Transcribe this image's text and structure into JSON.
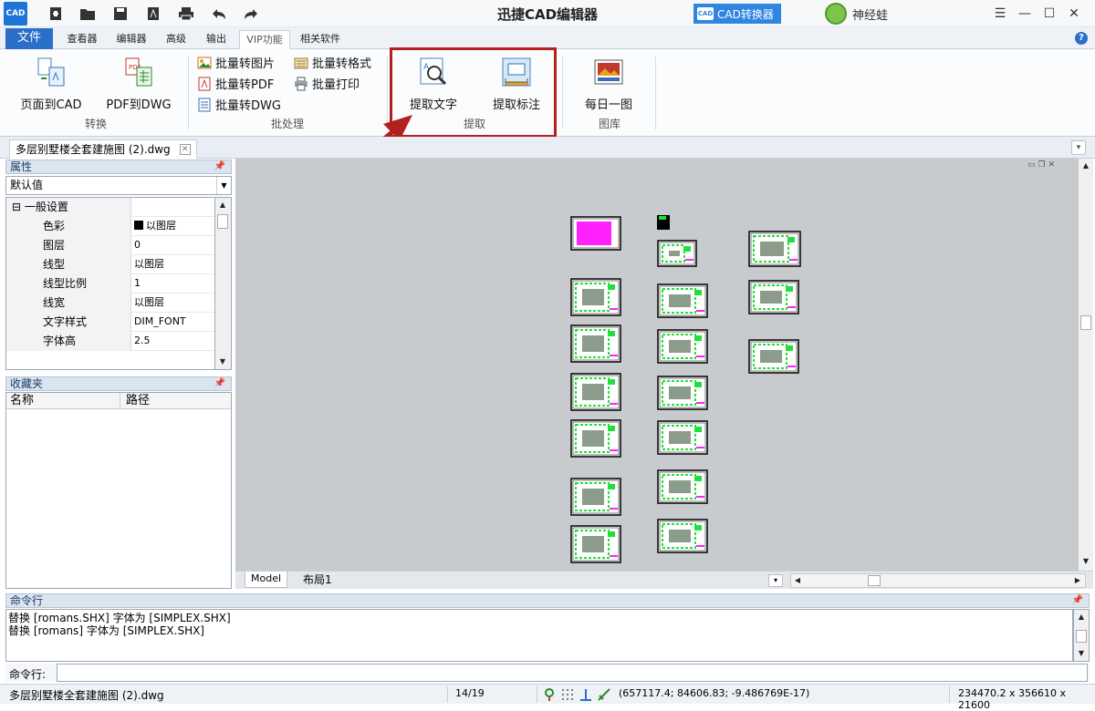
{
  "title_bar": {
    "logo_text": "CAD",
    "app_title": "迅捷CAD编辑器",
    "converter_button": "CAD转换器",
    "converter_icon_text": "CAD",
    "user_name": "神经蛙",
    "quick_access_icons": [
      "new-file-icon",
      "open-folder-icon",
      "save-icon",
      "pdf-icon",
      "print-icon",
      "undo-icon",
      "redo-icon"
    ],
    "window_controls": [
      "menu-icon",
      "minimize-icon",
      "maximize-icon",
      "close-icon"
    ]
  },
  "ribbon_tabs": [
    "文件",
    "查看器",
    "编辑器",
    "高级",
    "输出",
    "VIP功能",
    "相关软件"
  ],
  "active_tab": "VIP功能",
  "ribbon": {
    "groups": {
      "convert": {
        "label": "转换",
        "page_to_cad": "页面到CAD",
        "pdf_to_dwg": "PDF到DWG"
      },
      "batch": {
        "label": "批处理",
        "to_image": "批量转图片",
        "to_pdf": "批量转PDF",
        "to_dwg": "批量转DWG",
        "to_format": "批量转格式",
        "print": "批量打印"
      },
      "extract": {
        "label": "提取",
        "extract_text": "提取文字",
        "extract_dimension": "提取标注"
      },
      "gallery": {
        "label": "图库",
        "daily_image": "每日一图"
      }
    }
  },
  "document_tab": {
    "name": "多层别墅楼全套建施图 (2).dwg"
  },
  "properties_panel": {
    "title": "属性",
    "selector_value": "默认值",
    "category": "一般设置",
    "rows": [
      {
        "key": "色彩",
        "value": "以图层"
      },
      {
        "key": "图层",
        "value": "0"
      },
      {
        "key": "线型",
        "value": "以图层"
      },
      {
        "key": "线型比例",
        "value": "1"
      },
      {
        "key": "线宽",
        "value": "以图层"
      },
      {
        "key": "文字样式",
        "value": "DIM_FONT"
      },
      {
        "key": "字体高",
        "value": "2.5"
      }
    ]
  },
  "favorites_panel": {
    "title": "收藏夹",
    "columns": [
      "名称",
      "路径"
    ]
  },
  "layout_tabs": [
    "Model",
    "布局1"
  ],
  "command_panel": {
    "title": "命令行",
    "output_lines": [
      "替换 [romans.SHX] 字体为 [SIMPLEX.SHX]",
      "替换 [romans] 字体为 [SIMPLEX.SHX]"
    ],
    "input_label": "命令行:",
    "input_value": ""
  },
  "status_bar": {
    "file_name": "多层别墅楼全套建施图 (2).dwg",
    "page": "14/19",
    "coordinates": "(657117.4; 84606.83; -9.486769E-17)",
    "drawing_size": "234470.2 x 356610 x 21600"
  },
  "colors": {
    "accent_blue": "#2a6fc9",
    "highlight_red": "#b32020",
    "canvas_bg": "#c8cbce",
    "drawing_green": "#22e03a",
    "drawing_magenta": "#ff22ff"
  }
}
